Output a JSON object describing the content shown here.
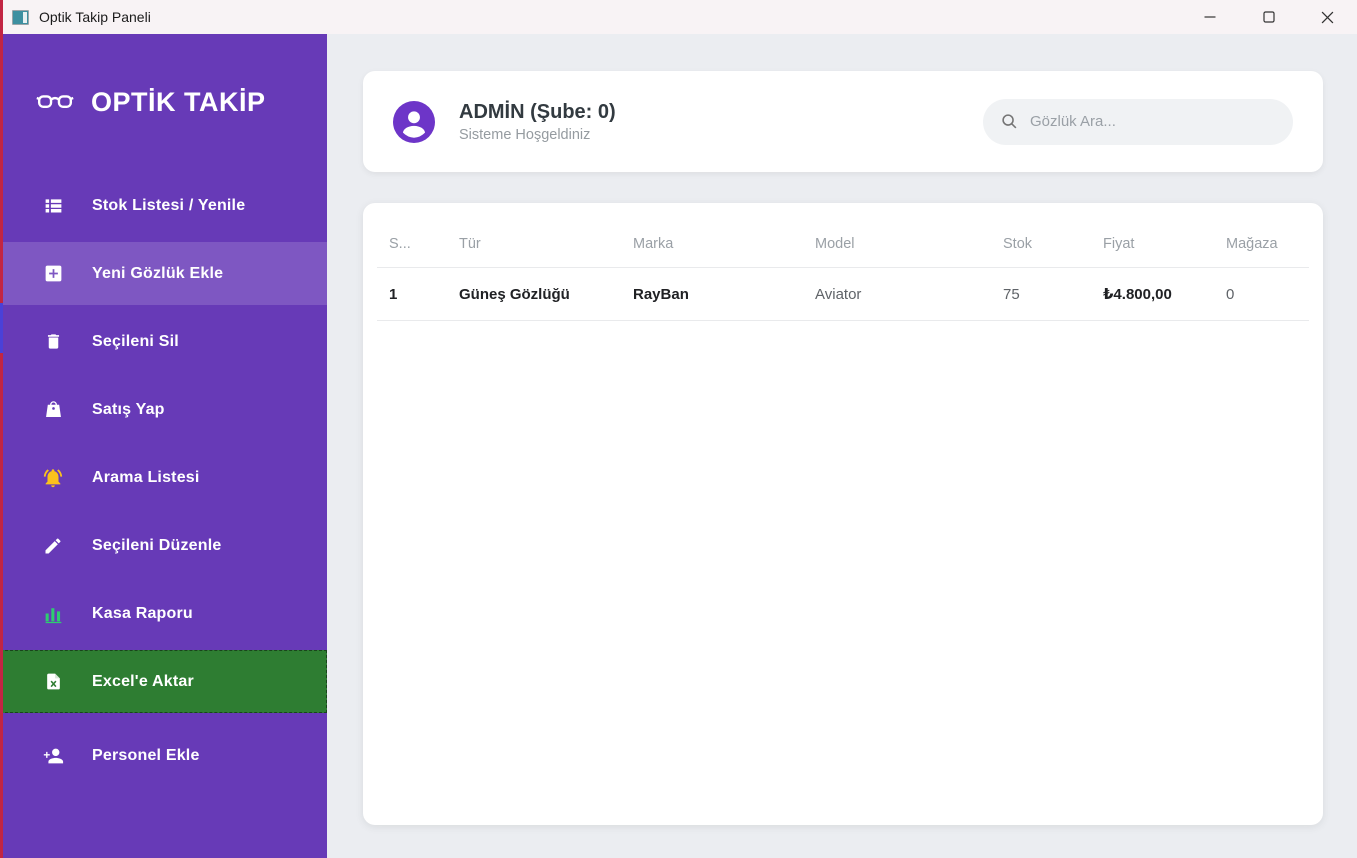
{
  "titlebar": {
    "title": "Optik Takip Paneli",
    "app_icon": "app-window-icon",
    "controls": {
      "minimize": "minimize-icon",
      "maximize": "maximize-icon",
      "close": "close-icon"
    }
  },
  "sidebar": {
    "logo": {
      "icon": "glasses-icon",
      "text": "OPTİK TAKİP"
    },
    "items": [
      {
        "label": "Stok Listesi / Yenile",
        "icon": "list-icon",
        "state": "normal"
      },
      {
        "label": "Yeni Gözlük Ekle",
        "icon": "add-box-icon",
        "state": "active"
      },
      {
        "label": "Seçileni Sil",
        "icon": "trash-icon",
        "state": "normal"
      },
      {
        "label": "Satış Yap",
        "icon": "shopping-bag-icon",
        "state": "normal"
      },
      {
        "label": "Arama Listesi",
        "icon": "bell-icon",
        "state": "normal"
      },
      {
        "label": "Seçileni Düzenle",
        "icon": "pencil-icon",
        "state": "normal"
      },
      {
        "label": "Kasa Raporu",
        "icon": "bar-chart-icon",
        "state": "normal"
      },
      {
        "label": "Excel'e Aktar",
        "icon": "excel-file-icon",
        "state": "export-green"
      },
      {
        "label": "Personel Ekle",
        "icon": "person-add-icon",
        "state": "normal"
      }
    ]
  },
  "header": {
    "avatar_icon": "user-avatar-icon",
    "user_name": "ADMİN (Şube: 0)",
    "welcome": "Sisteme Hoşgeldiniz",
    "search_icon": "search-icon",
    "search_placeholder": "Gözlük Ara...",
    "search_value": ""
  },
  "table": {
    "columns": [
      "S...",
      "Tür",
      "Marka",
      "Model",
      "Stok",
      "Fiyat",
      "Mağaza"
    ],
    "rows": [
      {
        "sira": "1",
        "tur": "Güneş Gözlüğü",
        "marka": "RayBan",
        "model": "Aviator",
        "stok": "75",
        "fiyat": "₺4.800,00",
        "magaza": "0"
      }
    ]
  },
  "colors": {
    "sidebar_purple": "#673ab7",
    "sidebar_active_purple": "#7e57c2",
    "export_green": "#2e7d32",
    "avatar_purple": "#6d35c8",
    "bell_yellow": "#fbc11d",
    "chart_green": "#2ecc71",
    "main_background": "#ebedf1",
    "titlebar_background": "#f8f3f5",
    "edge_strip_red": "#c22543",
    "edge_strip_blue": "#4a41d8"
  }
}
